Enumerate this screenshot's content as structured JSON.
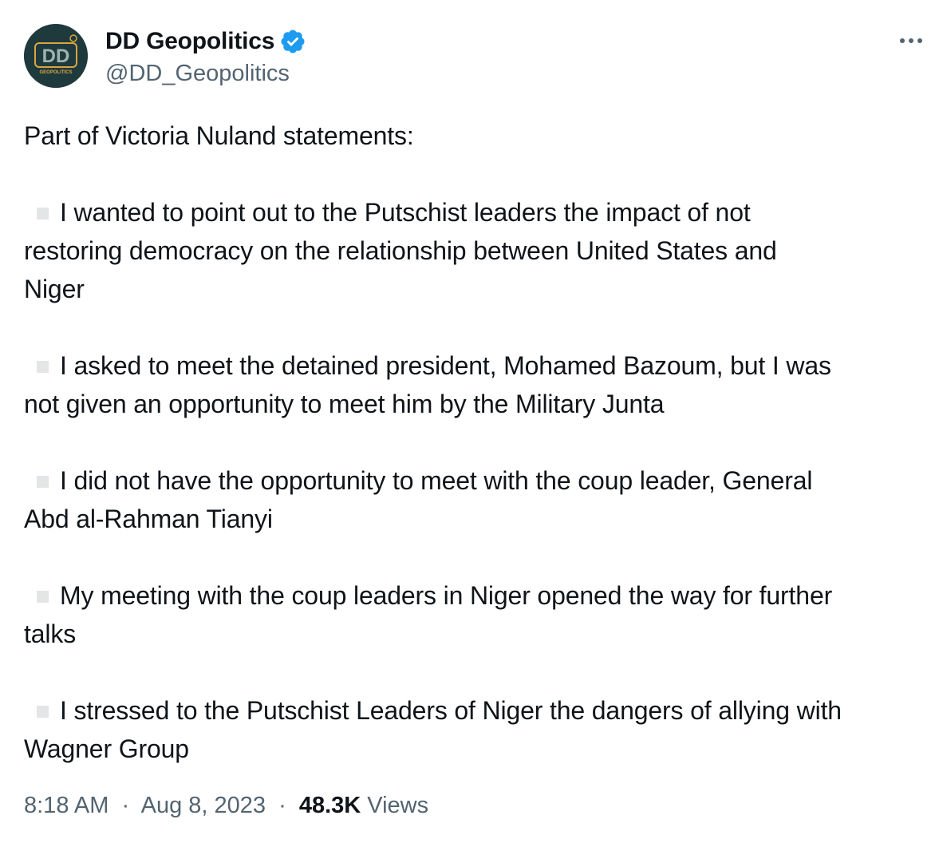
{
  "author": {
    "display_name": "DD Geopolitics",
    "handle": "@DD_Geopolitics",
    "verified": true,
    "avatar_text": "DD",
    "avatar_subtext": "GEOPOLITICS"
  },
  "tweet": {
    "intro": "Part of Victoria Nuland statements:",
    "points": [
      {
        "line1": "I wanted to point out to the Putschist leaders the impact of not",
        "rest": [
          "restoring democracy on the relationship between United States and",
          "Niger"
        ]
      },
      {
        "line1": "I asked to meet the detained president, Mohamed Bazoum, but I was",
        "rest": [
          "not given an opportunity to meet him by the Military Junta"
        ]
      },
      {
        "line1": "I did not have the opportunity to meet with the coup leader, General",
        "rest": [
          "Abd al-Rahman Tianyi"
        ]
      },
      {
        "line1": "My meeting with the coup leaders in Niger opened the way for further",
        "rest": [
          "talks"
        ]
      },
      {
        "line1": "I stressed to the Putschist Leaders of Niger the dangers of allying with",
        "rest": [
          "Wagner Group"
        ]
      }
    ]
  },
  "meta": {
    "time": "8:18 AM",
    "separator": "·",
    "date": "Aug 8, 2023",
    "views_count": "48.3K",
    "views_label": "Views"
  },
  "colors": {
    "text": "#0f1419",
    "secondary": "#536471",
    "verified": "#1d9bf0",
    "bullet": "#e3e5e7",
    "avatar_bg": "#1f3a3d",
    "avatar_accent": "#d9a441"
  },
  "icons": {
    "verified": "verified-badge-icon",
    "more": "more-options-icon",
    "bullet": "square-bullet-icon"
  }
}
